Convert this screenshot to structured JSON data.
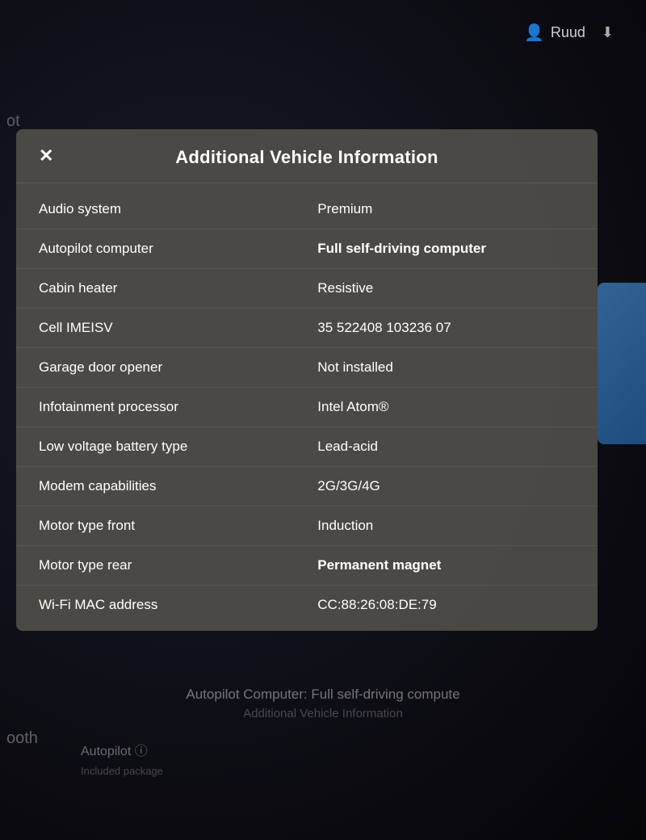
{
  "topbar": {
    "username": "Ruud",
    "user_icon": "👤",
    "download_icon": "⬇"
  },
  "background": {
    "label_oot": "ot",
    "label_booth": "ooth",
    "autopilot_bottom": "Autopilot Computer: Full self-driving compute",
    "additional_bottom": "Additional Vehicle Information",
    "autopilot2": "Autopilot ⓘ",
    "included": "Included package"
  },
  "modal": {
    "title": "Additional Vehicle Information",
    "close_label": "✕",
    "rows": [
      {
        "label": "Audio system",
        "value": "Premium",
        "bold": false
      },
      {
        "label": "Autopilot computer",
        "value": "Full self-driving computer",
        "bold": true
      },
      {
        "label": "Cabin heater",
        "value": "Resistive",
        "bold": false
      },
      {
        "label": "Cell IMEISV",
        "value": "35 522408 103236 07",
        "bold": false
      },
      {
        "label": "Garage door opener",
        "value": "Not installed",
        "bold": false
      },
      {
        "label": "Infotainment processor",
        "value": "Intel Atom®",
        "bold": false
      },
      {
        "label": "Low voltage battery type",
        "value": "Lead-acid",
        "bold": false
      },
      {
        "label": "Modem capabilities",
        "value": "2G/3G/4G",
        "bold": false
      },
      {
        "label": "Motor type front",
        "value": "Induction",
        "bold": false
      },
      {
        "label": "Motor type rear",
        "value": "Permanent magnet",
        "bold": true
      },
      {
        "label": "Wi-Fi MAC address",
        "value": "CC:88:26:08:DE:79",
        "bold": false
      }
    ]
  }
}
